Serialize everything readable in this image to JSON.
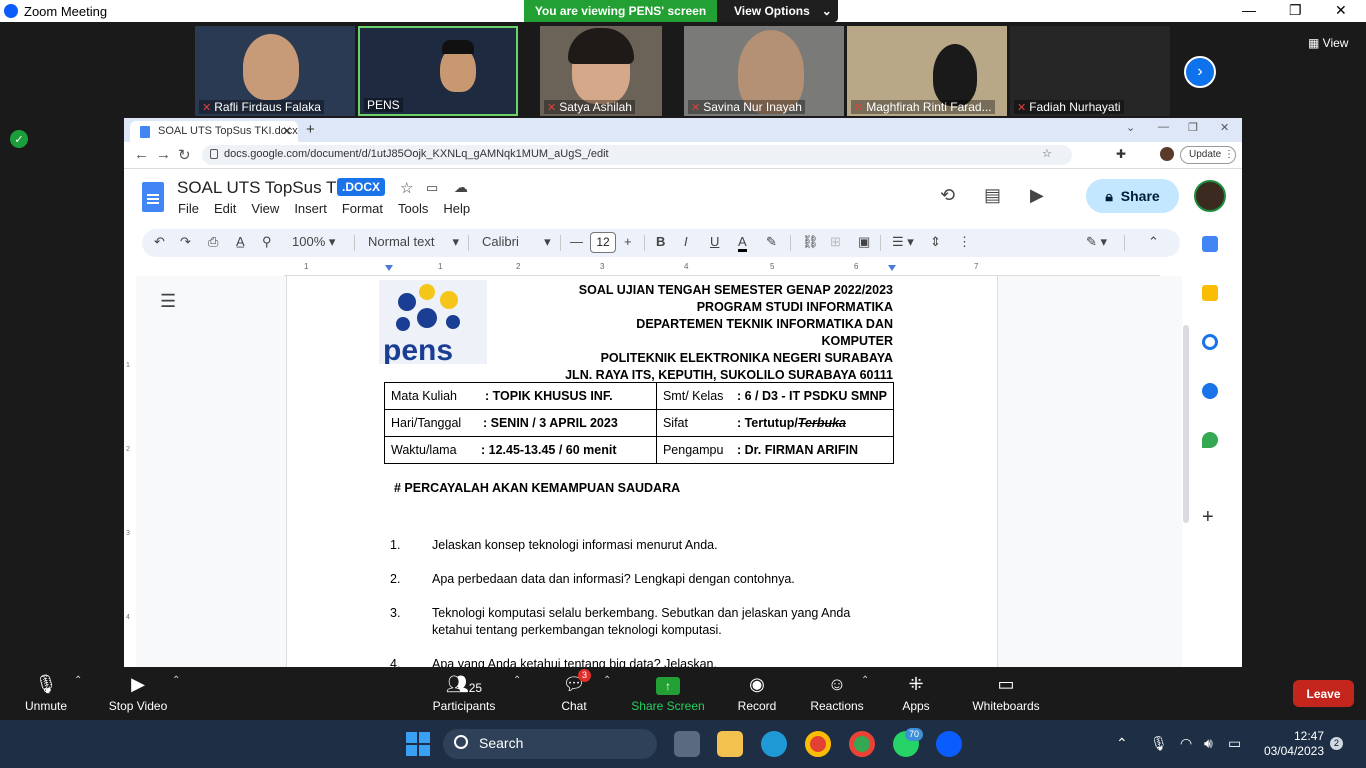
{
  "zoom": {
    "window_title": "Zoom Meeting",
    "viewing_banner": "You are viewing PENS' screen",
    "view_options": "View Options",
    "view_label": "View",
    "participants_tiles": [
      {
        "name": "Rafli Firdaus Falaka",
        "muted": true
      },
      {
        "name": "PENS",
        "muted": false
      },
      {
        "name": "Satya Ashilah",
        "muted": true
      },
      {
        "name": "Savina Nur Inayah",
        "muted": true
      },
      {
        "name": "Maghfirah Rinti Farad...",
        "muted": true
      },
      {
        "name": "Fadiah Nurhayati",
        "muted": true
      }
    ],
    "controls": {
      "unmute": "Unmute",
      "stop_video": "Stop Video",
      "participants": "Participants",
      "participants_count": "25",
      "chat": "Chat",
      "chat_badge": "3",
      "share_screen": "Share Screen",
      "record": "Record",
      "reactions": "Reactions",
      "apps": "Apps",
      "whiteboards": "Whiteboards",
      "leave": "Leave"
    }
  },
  "browser": {
    "tab_title": "SOAL UTS TopSus TKI.docx - Goo",
    "url": "docs.google.com/document/d/1utJ85Oojk_KXNLq_gAMNqk1MUM_aUgS_/edit",
    "update_label": "Update"
  },
  "docs": {
    "title": "SOAL UTS TopSus TKI",
    "badge": ".DOCX",
    "menus": [
      "File",
      "Edit",
      "View",
      "Insert",
      "Format",
      "Tools",
      "Help"
    ],
    "share": "Share",
    "zoom": "100%",
    "style": "Normal text",
    "font": "Calibri",
    "font_size": "12",
    "ruler_numbers": [
      "1",
      "1",
      "2",
      "3",
      "4",
      "5",
      "6",
      "7"
    ],
    "vruler_numbers": [
      "1",
      "2",
      "3",
      "4"
    ]
  },
  "document": {
    "logo_text": "pens",
    "header_lines": [
      "SOAL UJIAN TENGAH SEMESTER GENAP 2022/2023",
      "PROGRAM STUDI INFORMATIKA",
      "DEPARTEMEN TEKNIK INFORMATIKA DAN KOMPUTER",
      "POLITEKNIK ELEKTRONIKA NEGERI SURABAYA",
      "JLN. RAYA ITS, KEPUTIH, SUKOLILO SURABAYA 60111"
    ],
    "info_table": [
      {
        "l_label": "Mata Kuliah",
        "l_value": ": TOPIK KHUSUS INF.",
        "r_label": "Smt/ Kelas",
        "r_value": ": 6 / D3 - IT PSDKU SMNP"
      },
      {
        "l_label": "Hari/Tanggal",
        "l_value": ": SENIN / 3 APRIL 2023",
        "r_label": "Sifat",
        "r_value": ": Tertutup/",
        "r_value_struck": "Terbuka"
      },
      {
        "l_label": "Waktu/lama",
        "l_value": ":  12.45-13.45 / 60 menit",
        "r_label": "Pengampu",
        "r_value": ": Dr. FIRMAN ARIFIN"
      }
    ],
    "instruction": "# PERCAYALAH AKAN KEMAMPUAN SAUDARA",
    "questions": [
      {
        "num": "1.",
        "text": "Jelaskan konsep teknologi informasi menurut Anda."
      },
      {
        "num": "2.",
        "text": "Apa perbedaan data dan informasi? Lengkapi dengan contohnya."
      },
      {
        "num": "3.",
        "text": "Teknologi komputasi selalu berkembang. Sebutkan dan jelaskan yang Anda ketahui tentang perkembangan teknologi komputasi."
      },
      {
        "num": "4.",
        "text": "Apa yang Anda ketahui tentang big data? Jelaskan."
      }
    ]
  },
  "taskbar": {
    "search": "Search",
    "time": "12:47",
    "date": "03/04/2023",
    "whatsapp_badge": "70",
    "notif_badge": "2"
  },
  "colors": {
    "zoom_green": "#23a033",
    "zoom_blue": "#0e72ed",
    "docs_blue": "#1a73e8",
    "leave_red": "#c4261d",
    "taskbar": "#1e2f45"
  }
}
